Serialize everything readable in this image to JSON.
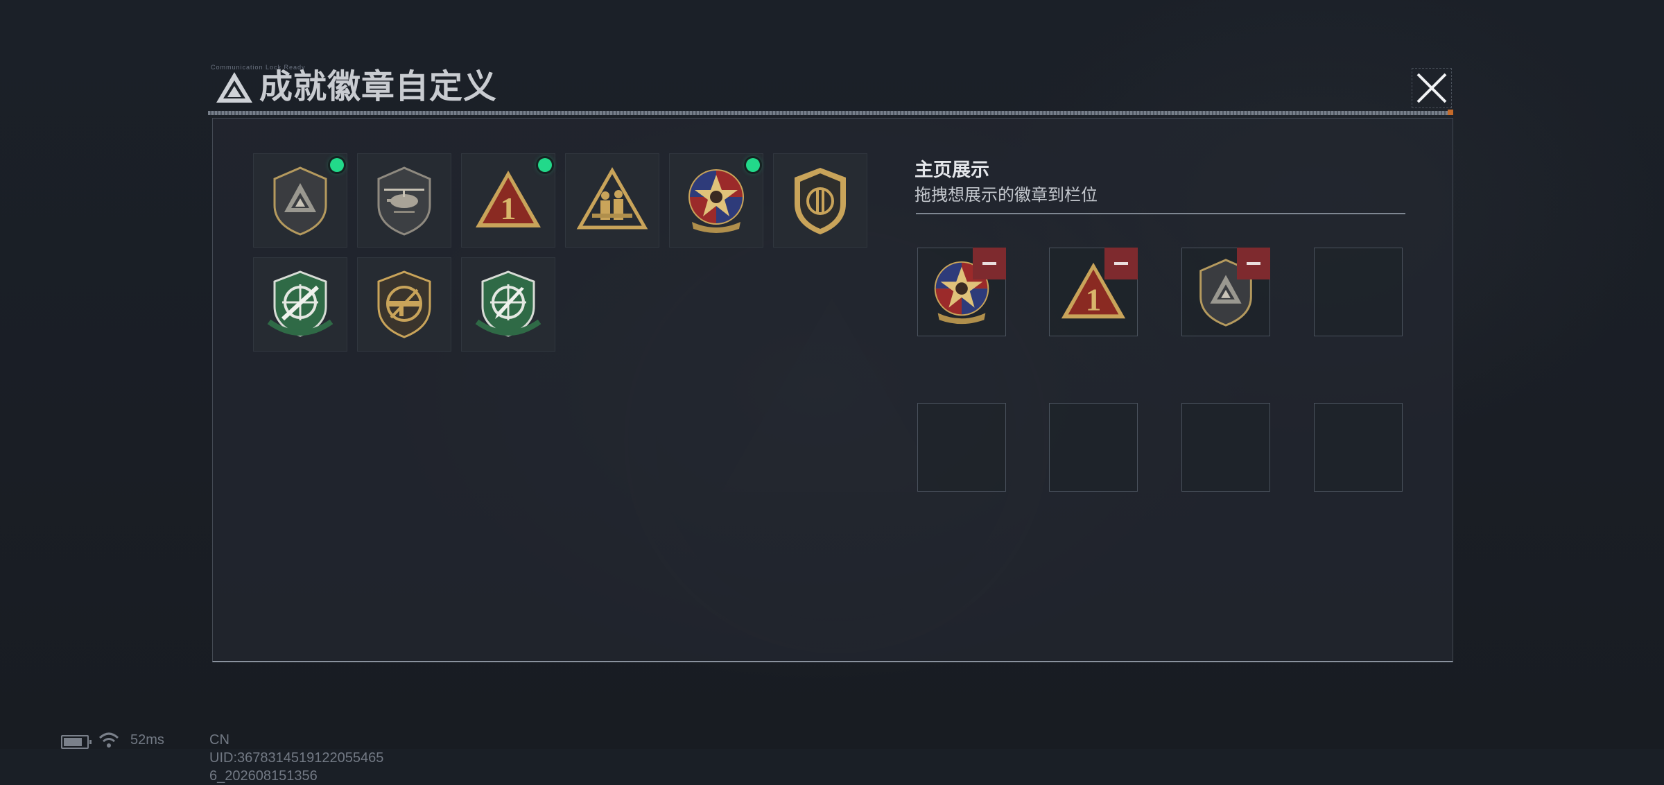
{
  "title": "成就徽章自定义",
  "title_deco": "Communication Lock Ready",
  "showcase": {
    "heading": "主页展示",
    "hint": "拖拽想展示的徽章到栏位"
  },
  "badges": [
    {
      "icon": "gray-shield-triangle-badge-icon",
      "new": true
    },
    {
      "icon": "helicopter-shield-badge-icon",
      "new": false
    },
    {
      "icon": "red-triangle-number-one-badge-icon",
      "new": true
    },
    {
      "icon": "soldiers-triangle-badge-icon",
      "new": false
    },
    {
      "icon": "star-medal-badge-icon",
      "new": true
    },
    {
      "icon": "gold-shield-emblem-badge-icon",
      "new": false
    },
    {
      "icon": "green-sniper-rifle-badge-icon",
      "new": false
    },
    {
      "icon": "bronze-smg-badge-icon",
      "new": false
    },
    {
      "icon": "green-knife-badge-icon",
      "new": false
    }
  ],
  "slots": [
    {
      "icon": "star-medal-badge-icon",
      "filled": true
    },
    {
      "icon": "red-triangle-number-one-badge-icon",
      "filled": true
    },
    {
      "icon": "gray-shield-triangle-badge-icon",
      "filled": true
    },
    {
      "filled": false
    },
    {
      "filled": false
    },
    {
      "filled": false
    },
    {
      "filled": false
    },
    {
      "filled": false
    }
  ],
  "colors": {
    "new_indicator": "#22d98a",
    "remove_button": "#7e2a2e",
    "badge_gold": "#c9a45a"
  },
  "status_bar": {
    "ping": "52ms",
    "uid": "CN UID:3678314519122055465​6_202608151356"
  }
}
